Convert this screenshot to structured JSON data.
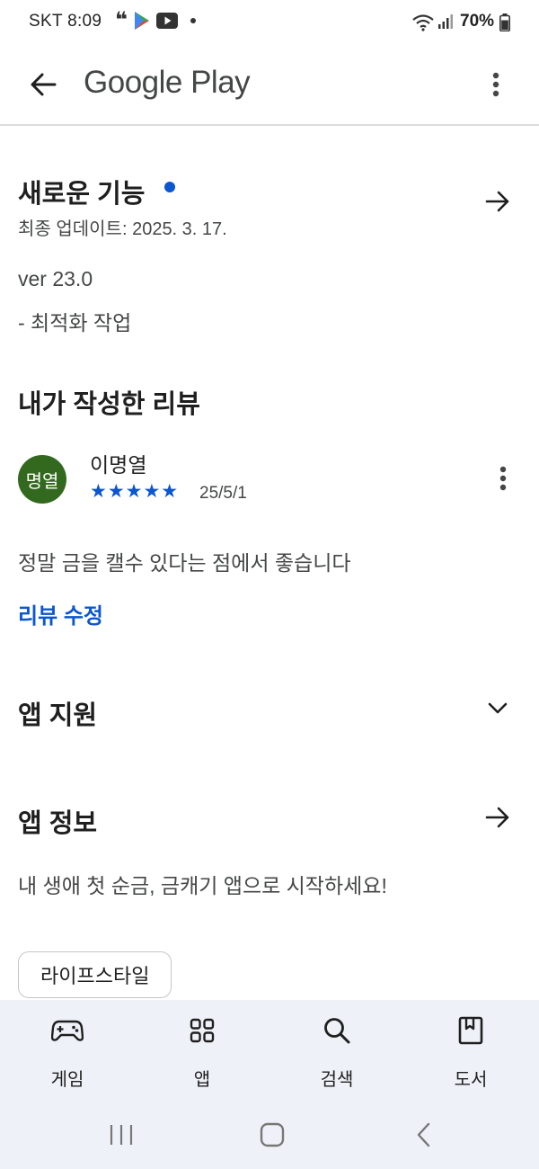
{
  "status_bar": {
    "carrier_time": "SKT 8:09",
    "battery": "70%"
  },
  "app_bar": {
    "title": "Google Play"
  },
  "whats_new": {
    "title": "새로운 기능",
    "last_updated": "최종 업데이트: 2025. 3. 17.",
    "version": "ver 23.0",
    "notes": "- 최적화 작업"
  },
  "my_review": {
    "title": "내가 작성한 리뷰",
    "avatar_text": "명열",
    "reviewer_name": "이명열",
    "rating": 5,
    "stars": "★★★★★",
    "date": "25/5/1",
    "text": "정말 금을 캘수 있다는 점에서 좋습니다",
    "edit_label": "리뷰 수정"
  },
  "app_support": {
    "title": "앱 지원"
  },
  "app_info": {
    "title": "앱 정보",
    "description": "내 생애 첫 순금, 금캐기 앱으로 시작하세요!",
    "category_chip": "라이프스타일"
  },
  "bottom_nav": {
    "items": [
      {
        "label": "게임",
        "icon": "gamepad-icon"
      },
      {
        "label": "앱",
        "icon": "apps-grid-icon"
      },
      {
        "label": "검색",
        "icon": "search-icon"
      },
      {
        "label": "도서",
        "icon": "book-icon"
      }
    ]
  },
  "colors": {
    "accent": "#0b57d0",
    "avatar_bg": "#33691e",
    "nav_bg": "#eef2f8"
  }
}
